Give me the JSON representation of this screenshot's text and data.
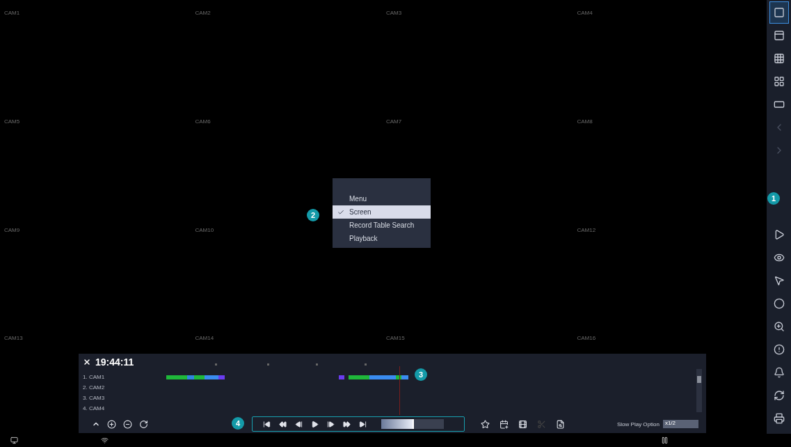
{
  "cameras": [
    "CAM1",
    "CAM2",
    "CAM3",
    "CAM4",
    "CAM5",
    "CAM6",
    "CAM7",
    "CAM8",
    "CAM9",
    "CAM10",
    "CAM12",
    "CAM13",
    "CAM14",
    "CAM15",
    "CAM16"
  ],
  "sidebar": {
    "layout_buttons": [
      {
        "selected": true
      },
      {
        "selected": false
      },
      {
        "selected": false
      },
      {
        "selected": false
      },
      {
        "selected": false
      }
    ],
    "page_buttons": [
      {
        "disabled": true
      },
      {
        "disabled": true
      }
    ]
  },
  "context_menu": {
    "items": [
      {
        "label": "Menu",
        "checked": false
      },
      {
        "label": "Screen",
        "checked": true
      },
      {
        "label": "Record Table Search",
        "checked": false
      },
      {
        "label": "Playback",
        "checked": false
      }
    ]
  },
  "callouts": [
    "1",
    "2",
    "3",
    "4"
  ],
  "playback": {
    "time": "19:44:11",
    "channels": [
      "1. CAM1",
      "2. CAM2",
      "3. CAM3",
      "4. CAM4"
    ],
    "segments": [
      {
        "color": "#1fb83a"
      },
      {
        "color": "#2f86e0"
      },
      {
        "color": "#1fb83a"
      },
      {
        "color": "#3a8cf0"
      },
      {
        "color": "#6a3cf0"
      },
      {
        "color": "#6a3cf0"
      },
      {
        "color": "#1fb83a"
      },
      {
        "color": "#3a8cf0"
      },
      {
        "color": "#1fb83a"
      },
      {
        "color": "#3a8cf0"
      }
    ],
    "jog": {
      "level": 0.5
    },
    "slow_play": {
      "label": "Slow Play Option",
      "value": "x1/2"
    }
  }
}
